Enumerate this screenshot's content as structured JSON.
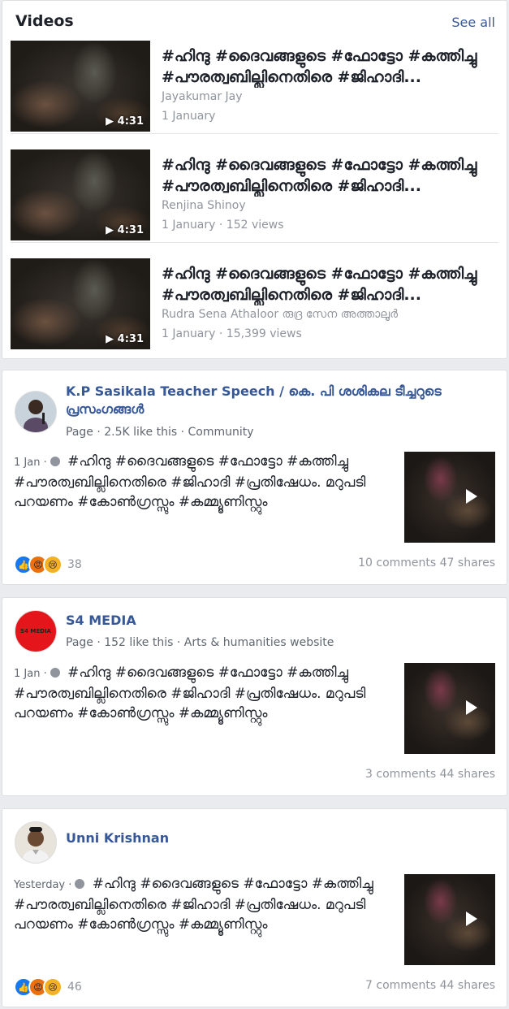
{
  "videos": {
    "heading": "Videos",
    "see_all": "See all",
    "items": [
      {
        "title_line1": "#ഹിന്ദു #ദൈവങ്ങളുടെ #ഫോട്ടോ #കത്തിച്ചു",
        "title_line2": "#പൗരത്വബില്ലിനെതിരെ #ജിഹാദി...",
        "author": "Jayakumar Jay",
        "meta": "1 January",
        "duration": "4:31"
      },
      {
        "title_line1": "#ഹിന്ദു #ദൈവങ്ങളുടെ #ഫോട്ടോ #കത്തിച്ചു",
        "title_line2": "#പൗരത്വബില്ലിനെതിരെ #ജിഹാദി...",
        "author": "Renjina Shinoy",
        "meta": "1 January · 152 views",
        "duration": "4:31"
      },
      {
        "title_line1": "#ഹിന്ദു #ദൈവങ്ങളുടെ #ഫോട്ടോ #കത്തിച്ചു",
        "title_line2": "#പൗരത്വബില്ലിനെതിരെ #ജിഹാദി...",
        "author": "Rudra Sena Athaloor രുദ്ര സേന അത്താലൂർ",
        "meta": "1 January · 15,399 views",
        "duration": "4:31"
      }
    ]
  },
  "posts": [
    {
      "name": "K.P Sasikala Teacher Speech / കെ. പി ശശികല ടീച്ചറുടെ പ്രസംഗങ്ങൾ",
      "sub": "Page · 2.5K like this · Community",
      "time": "1 Jan ·",
      "text": "#ഹിന്ദു #ദൈവങ്ങളുടെ #ഫോട്ടോ #കത്തിച്ചു #പൗരത്വബില്ലിനെതിരെ #ജിഹാദി #പ്രതിഷേധം. മറുപടി പറയണം #കോൺഗ്രസ്സും #കമ്മ്യൂണിസ്റ്റും",
      "reactions": "38",
      "stats": "10 comments   47 shares"
    },
    {
      "name": "S4 MEDIA",
      "sub": "Page · 152 like this · Arts & humanities website",
      "avatar_text": "S4 MEDIA",
      "time": "1 Jan ·",
      "text": "#ഹിന്ദു #ദൈവങ്ങളുടെ #ഫോട്ടോ #കത്തിച്ചു #പൗരത്വബില്ലിനെതിരെ #ജിഹാദി #പ്രതിഷേധം. മറുപടി പറയണം #കോൺഗ്രസ്സും #കമ്മ്യൂണിസ്റ്റും",
      "stats": "3 comments   44 shares"
    },
    {
      "name": "Unni Krishnan",
      "time": "Yesterday ·",
      "text": "#ഹിന്ദു #ദൈവങ്ങളുടെ #ഫോട്ടോ #കത്തിച്ചു #പൗരത്വബില്ലിനെതിരെ #ജിഹാദി #പ്രതിഷേധം. മറുപടി പറയണം #കോൺഗ്രസ്സും #കമ്മ്യൂണിസ്റ്റും",
      "reactions": "46",
      "stats": "7 comments   44 shares"
    }
  ],
  "colors": {
    "link": "#385898",
    "name": "#365899",
    "muted": "#90949c",
    "bg": "#e9ebee"
  }
}
